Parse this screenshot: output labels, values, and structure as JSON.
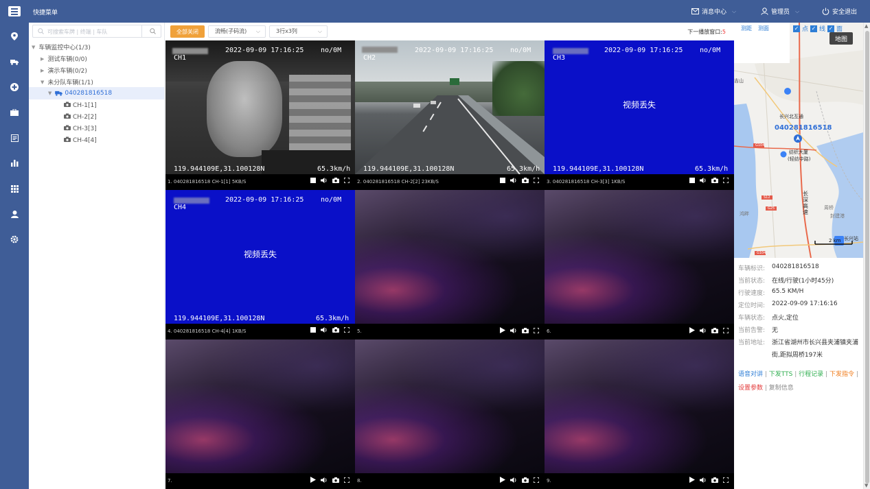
{
  "topbar": {
    "title": "快捷菜单",
    "message_center": "消息中心",
    "admin": "管理员",
    "logout": "安全退出"
  },
  "sidebar_icons": [
    "location-icon",
    "truck-icon",
    "plus-circle-icon",
    "briefcase-icon",
    "report-icon",
    "bar-chart-icon",
    "grid-icon",
    "user-icon",
    "settings-icon"
  ],
  "tree": {
    "search_placeholder": "可搜索车牌 | 终端 | 车队",
    "nodes": [
      {
        "label": "车辆监控中心(1/3)"
      },
      {
        "label": "测试车辆(0/0)"
      },
      {
        "label": "演示车辆(0/2)"
      },
      {
        "label": "未分队车辆(1/1)"
      },
      {
        "label": "040281816518"
      },
      {
        "label": "CH-1[1]"
      },
      {
        "label": "CH-2[2]"
      },
      {
        "label": "CH-3[3]"
      },
      {
        "label": "CH-4[4]"
      }
    ]
  },
  "toolbar": {
    "close_all": "全部关闭",
    "stream": "流畅(子码流)",
    "layout": "3行x3列",
    "next_window_label": "下一播放窗口:",
    "next_window_value": "5"
  },
  "cells": [
    {
      "label": "1. 040281816518 CH-1[1] 5KB/S",
      "channel": "CH1",
      "time": "2022-09-09 17:16:25",
      "status": "no/0M",
      "coords": "119.944109E,31.100128N",
      "speed": "65.3km/h"
    },
    {
      "label": "2. 040281816518 CH-2[2] 23KB/S",
      "channel": "CH2",
      "time": "2022-09-09 17:16:25",
      "status": "no/0M",
      "coords": "119.944109E,31.100128N",
      "speed": "65.3km/h"
    },
    {
      "label": "3. 040281816518 CH-3[3] 1KB/S",
      "channel": "CH3",
      "time": "2022-09-09 17:16:25",
      "status": "no/0M",
      "coords": "119.944109E,31.100128N",
      "speed": "65.3km/h",
      "lost": "视频丢失"
    },
    {
      "label": "4. 040281816518 CH-4[4] 1KB/S",
      "channel": "CH4",
      "time": "2022-09-09 17:16:25",
      "status": "no/0M",
      "coords": "119.944109E,31.100128N",
      "speed": "65.3km/h",
      "lost": "视频丢失"
    },
    {
      "label": "5."
    },
    {
      "label": "6."
    },
    {
      "label": "7."
    },
    {
      "label": "8."
    },
    {
      "label": "9."
    }
  ],
  "map": {
    "tool_distance": "测距",
    "tool_area": "测面",
    "layer_point": "点",
    "layer_line": "线",
    "layer_area": "面",
    "map_button": "地图",
    "vehicle_label": "040281816518",
    "place_1": "长兴北互通",
    "place_2": "纺织大厦",
    "place_3": "(轻纺中路)",
    "highway_name": "长深高速",
    "place_4": "周桥",
    "station": "长兴站",
    "scale": "2 km",
    "road_1": "G104",
    "road_2": "S12",
    "road_3": "G25",
    "place_5": "吉山",
    "place_6": "鸿畔",
    "place_7": "封建港"
  },
  "info": {
    "rows": [
      {
        "k": "车辆标识:",
        "v": "040281816518"
      },
      {
        "k": "当前状态:",
        "v": "在线/行驶(1小时45分)"
      },
      {
        "k": "行驶速度:",
        "v": "65.5 KM/H"
      },
      {
        "k": "定位时间:",
        "v": "2022-09-09 17:16:16"
      },
      {
        "k": "车辆状态:",
        "v": "点火,定位"
      },
      {
        "k": "当前告警:",
        "v": "无"
      },
      {
        "k": "当前地址:",
        "v": "浙江省湖州市长兴县夹浦镇夹浦"
      },
      {
        "k": "",
        "v": "街,距拟周桥197米"
      }
    ],
    "links": [
      "语音对讲",
      "下发TTS",
      "行程记录",
      "下发指令",
      "设置参数",
      "复制信息"
    ],
    "link_colors": [
      "#2e7ed6",
      "#2fae4f",
      "#2fae4f",
      "#f07b1a",
      "#e33b3b",
      "#888888"
    ]
  },
  "colors": {
    "header": "#3f5d97",
    "accent_orange": "#f0a13a",
    "video_lost_blue": "#0a10c8"
  }
}
